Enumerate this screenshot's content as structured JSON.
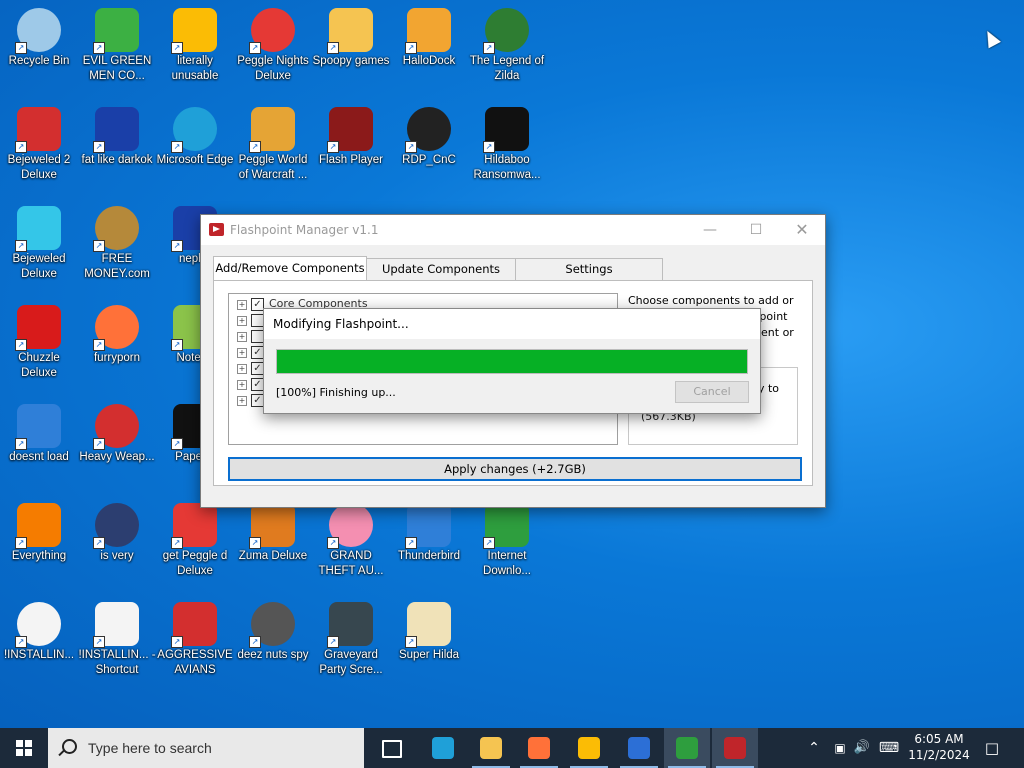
{
  "desktop": {
    "icons": [
      {
        "label": "Recycle Bin",
        "icon": "recycle-bin-icon",
        "color": "#9ec9e8",
        "col": 0,
        "row": 0
      },
      {
        "label": "EVIL GREEN MEN CO...",
        "icon": "green-people-icon",
        "color": "#3cb043",
        "col": 1,
        "row": 0
      },
      {
        "label": "literally unusable",
        "icon": "chrome-icon",
        "color": "#fbbc05",
        "col": 2,
        "row": 0
      },
      {
        "label": "Peggle Nights Deluxe",
        "icon": "peggle-icon",
        "color": "#e53935",
        "col": 3,
        "row": 0
      },
      {
        "label": "Spoopy games",
        "icon": "folder-icon",
        "color": "#f5c451",
        "col": 4,
        "row": 0
      },
      {
        "label": "HalloDock",
        "icon": "windows-shield-icon",
        "color": "#f2a531",
        "col": 5,
        "row": 0
      },
      {
        "label": "The Legend of Zilda",
        "icon": "game-character-icon",
        "color": "#2e7d32",
        "col": 6,
        "row": 0
      },
      {
        "label": "Bejeweled 2 Deluxe",
        "icon": "bejeweled-2-icon",
        "color": "#d32f2f",
        "col": 0,
        "row": 1
      },
      {
        "label": "fat like darkok",
        "icon": "mpi-logo-icon",
        "color": "#1a3fa8",
        "col": 1,
        "row": 1
      },
      {
        "label": "Microsoft Edge",
        "icon": "edge-icon",
        "color": "#1fa0d8",
        "col": 2,
        "row": 1
      },
      {
        "label": "Peggle World of Warcraft ...",
        "icon": "peggle-icon",
        "color": "#e5a435",
        "col": 3,
        "row": 1
      },
      {
        "label": "Flash Player",
        "icon": "flash-player-icon",
        "color": "#8b1a1a",
        "col": 4,
        "row": 1
      },
      {
        "label": "RDP_CnC",
        "icon": "rdp-icon",
        "color": "#222222",
        "col": 5,
        "row": 1
      },
      {
        "label": "Hildaboo Ransomwa...",
        "icon": "yashma-icon",
        "color": "#111111",
        "col": 6,
        "row": 1
      },
      {
        "label": "Bejeweled Deluxe",
        "icon": "gem-icon",
        "color": "#34c6e8",
        "col": 0,
        "row": 2
      },
      {
        "label": "FREE MONEY.com",
        "icon": "money-bag-icon",
        "color": "#b5893a",
        "col": 1,
        "row": 2
      },
      {
        "label": "nepha",
        "icon": "mpi-logo-icon",
        "color": "#1a3fa8",
        "col": 2,
        "row": 2
      },
      {
        "label": "Chuzzle Deluxe",
        "icon": "chuzzle-icon",
        "color": "#d81b1b",
        "col": 0,
        "row": 3
      },
      {
        "label": "furryporn",
        "icon": "firefox-icon",
        "color": "#ff7139",
        "col": 1,
        "row": 3
      },
      {
        "label": "Notepa",
        "icon": "notepad-icon",
        "color": "#8bc34a",
        "col": 2,
        "row": 3
      },
      {
        "label": "doesnt load",
        "icon": "thunderbird-icon",
        "color": "#2f7fd8",
        "col": 0,
        "row": 4
      },
      {
        "label": "Heavy Weap...",
        "icon": "radiation-icon",
        "color": "#d32f2f",
        "col": 1,
        "row": 4
      },
      {
        "label": "Papers,",
        "icon": "papers-icon",
        "color": "#111111",
        "col": 2,
        "row": 4
      },
      {
        "label": "Everything",
        "icon": "search-everything-icon",
        "color": "#f57c00",
        "col": 0,
        "row": 5
      },
      {
        "label": "is very",
        "icon": "mpi-shield-icon",
        "color": "#2c3e70",
        "col": 1,
        "row": 5
      },
      {
        "label": "get Peggle d Deluxe",
        "icon": "peggle-icon",
        "color": "#e53935",
        "col": 2,
        "row": 5
      },
      {
        "label": "Zuma Deluxe",
        "icon": "zuma-icon",
        "color": "#e07b1f",
        "col": 3,
        "row": 5
      },
      {
        "label": "GRAND THEFT AU...",
        "icon": "anime-girl-icon",
        "color": "#f48fb1",
        "col": 4,
        "row": 5
      },
      {
        "label": "Thunderbird",
        "icon": "thunderbird-icon",
        "color": "#2f7fd8",
        "col": 5,
        "row": 5
      },
      {
        "label": "Internet Downlo...",
        "icon": "download-manager-icon",
        "color": "#2e9e3e",
        "col": 6,
        "row": 5
      },
      {
        "label": "!INSTALLIN...",
        "icon": "text-file-icon",
        "color": "#f4f4f4",
        "col": 0,
        "row": 6
      },
      {
        "label": "!INSTALLIN... - Shortcut",
        "icon": "text-file-icon",
        "color": "#f4f4f4",
        "col": 1,
        "row": 6
      },
      {
        "label": "AGGRESSIVE AVIANS",
        "icon": "angry-bird-icon",
        "color": "#d32f2f",
        "col": 2,
        "row": 6
      },
      {
        "label": "deez nuts spy",
        "icon": "stacked-windows-icon",
        "color": "#555555",
        "col": 3,
        "row": 6
      },
      {
        "label": "Graveyard Party Scre...",
        "icon": "graveyard-icon",
        "color": "#37474f",
        "col": 4,
        "row": 6
      },
      {
        "label": "Super Hilda",
        "icon": "pixel-character-icon",
        "color": "#f0e2b8",
        "col": 5,
        "row": 6
      }
    ]
  },
  "flashpoint": {
    "title": "Flashpoint Manager v1.1",
    "tabs": [
      {
        "label": "Add/Remove Components",
        "active": true
      },
      {
        "label": "Update Components",
        "active": false
      },
      {
        "label": "Settings",
        "active": false
      }
    ],
    "tree_first": "Core Components",
    "description": "Choose components to add or remove from your Flashpoint copy. Click on a component or category to see more information.",
    "info_text": "y to",
    "info_size": "(567.3KB)",
    "apply_label": "Apply changes (+2.7GB)"
  },
  "progress": {
    "title": "Modifying Flashpoint...",
    "percent": 100,
    "status": "[100%] Finishing up...",
    "cancel_label": "Cancel"
  },
  "taskbar": {
    "search_placeholder": "Type here to search",
    "apps": [
      {
        "name": "task-view",
        "color": "#ffffff"
      },
      {
        "name": "edge",
        "color": "#1fa0d8"
      },
      {
        "name": "file-explorer",
        "color": "#f5c451"
      },
      {
        "name": "firefox",
        "color": "#ff7139"
      },
      {
        "name": "chrome",
        "color": "#fbbc05"
      },
      {
        "name": "mpi-app",
        "color": "#2c6fd6"
      },
      {
        "name": "internet-download-manager",
        "color": "#2e9e3e"
      },
      {
        "name": "flashpoint-manager",
        "color": "#c0252a"
      }
    ],
    "time": "6:05 AM",
    "date": "11/2/2024"
  }
}
